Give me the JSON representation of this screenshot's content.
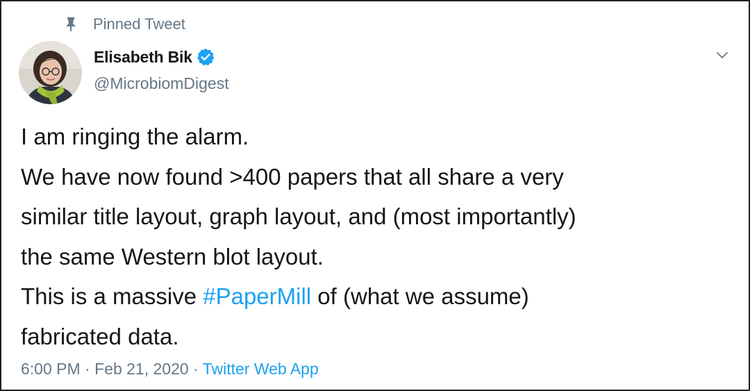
{
  "pinned": {
    "label": "Pinned Tweet",
    "icon": "pin-icon"
  },
  "author": {
    "name": "Elisabeth Bik",
    "handle": "@MicrobiomDigest",
    "verified": true,
    "verified_icon": "verified-badge-icon",
    "avatar": "avatar-photo"
  },
  "menu": {
    "icon": "chevron-down-icon"
  },
  "tweet": {
    "line1": "I am ringing the alarm.",
    "line2": "We have now found >400 papers that all share a very",
    "line3": "similar title layout, graph layout, and (most importantly)",
    "line4": "the same Western blot layout.",
    "line5_before": "This is a massive ",
    "hashtag": "#PaperMill",
    "line5_after": " of (what we assume)",
    "line6": "fabricated data."
  },
  "meta": {
    "time": "6:00 PM",
    "separator1": " · ",
    "date": "Feb 21, 2020",
    "separator2": " · ",
    "source": "Twitter Web App"
  },
  "colors": {
    "link": "#1da1f2",
    "secondary_text": "#657786",
    "primary_text": "#14171a",
    "border": "#222222"
  }
}
